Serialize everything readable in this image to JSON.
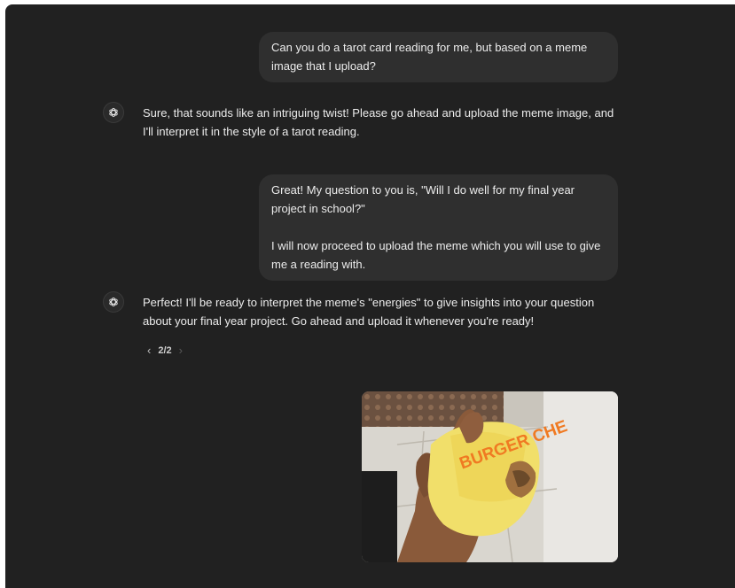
{
  "conversation": {
    "messages": [
      {
        "role": "user",
        "paragraphs": [
          "Can you do a tarot card reading for me, but based on a meme image that I upload?"
        ]
      },
      {
        "role": "assistant",
        "text": "Sure, that sounds like an intriguing twist! Please go ahead and upload the meme image, and I'll interpret it in the style of a tarot reading."
      },
      {
        "role": "user",
        "paragraphs": [
          "Great! My question to you is, \"Will I do well for my final year project in school?\"",
          "I will now proceed to upload the meme which you will use to give me a reading with."
        ]
      },
      {
        "role": "assistant",
        "text": "Perfect! I'll be ready to interpret the meme's \"energies\" to give insights into your question about your final year project. Go ahead and upload it whenever you're ready!"
      }
    ],
    "pager": {
      "label": "2/2",
      "prev_icon": "chevron-left-icon",
      "next_icon": "chevron-right-icon"
    },
    "uploaded_image": {
      "wrapper_text": "BURGER CHE"
    }
  },
  "colors": {
    "background": "#212121",
    "user_bubble": "#2f2f2f",
    "text": "#ececec",
    "wrapper_yellow": "#f1df6a",
    "wrapper_orange": "#f07a22"
  }
}
